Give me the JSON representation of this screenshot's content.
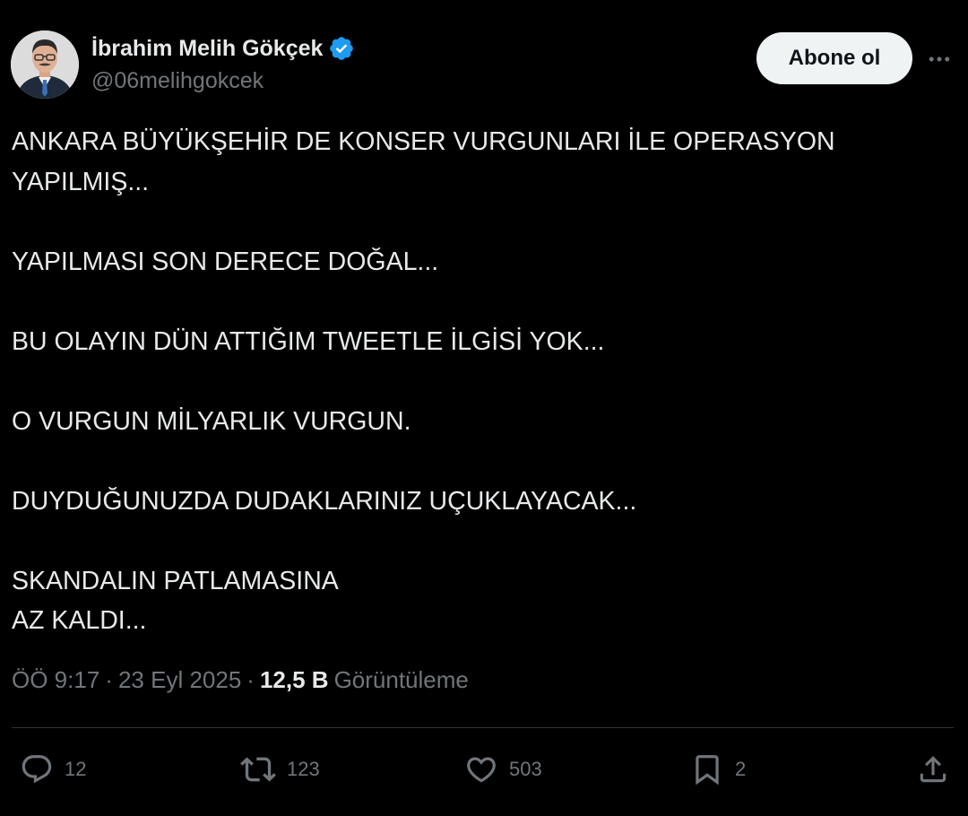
{
  "author": {
    "display_name": "İbrahim Melih Gökçek",
    "handle": "@06melihgokcek",
    "verified": true,
    "verified_color": "#1d9bf0"
  },
  "follow_button_label": "Abone ol",
  "tweet": {
    "paragraphs": [
      "ANKARA BÜYÜKŞEHİR DE KONSER VURGUNLARI İLE OPERASYON YAPILMIŞ...",
      "YAPILMASI SON DERECE DOĞAL...",
      "BU OLAYIN DÜN ATTIĞIM TWEETLE İLGİSİ YOK...",
      "O VURGUN MİLYARLIK VURGUN.",
      "DUYDUĞUNUZDA DUDAKLARINIZ UÇUKLAYACAK...",
      "SKANDALIN PATLAMASINA",
      "AZ KALDI..."
    ]
  },
  "meta": {
    "time": "ÖÖ 9:17",
    "separator": "·",
    "date": "23 Eyl 2025",
    "views_count": "12,5 B",
    "views_label": "Görüntüleme"
  },
  "actions": {
    "replies": "12",
    "reposts": "123",
    "likes": "503",
    "bookmarks": "2"
  },
  "icons": [
    "verified-badge-icon",
    "more-icon",
    "reply-icon",
    "repost-icon",
    "like-icon",
    "bookmark-icon",
    "share-icon"
  ],
  "colors": {
    "background": "#000000",
    "text": "#e7e9ea",
    "muted": "#71767b",
    "button_bg": "#eff3f4"
  }
}
